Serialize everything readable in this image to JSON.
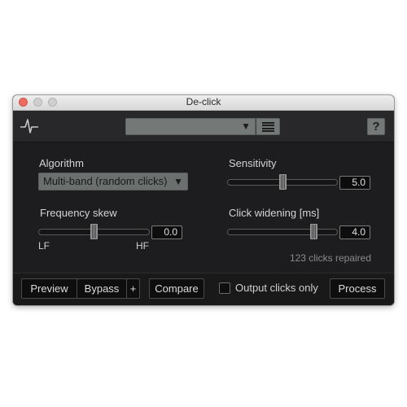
{
  "window": {
    "title": "De-click"
  },
  "header": {
    "preset_value": "",
    "preset_arrow": "▼",
    "help_label": "?"
  },
  "algorithm": {
    "label": "Algorithm",
    "value": "Multi-band (random clicks)",
    "arrow": "▼"
  },
  "sensitivity": {
    "label": "Sensitivity",
    "value": "5.0",
    "level": 0.5
  },
  "frequency_skew": {
    "label": "Frequency skew",
    "value": "0.0",
    "left_label": "LF",
    "right_label": "HF",
    "level": 0.5
  },
  "click_widening": {
    "label": "Click widening [ms]",
    "value": "4.0",
    "level": 0.78
  },
  "status": {
    "text": "123 clicks repaired"
  },
  "footer": {
    "preview": "Preview",
    "bypass": "Bypass",
    "plus": "+",
    "compare": "Compare",
    "output_clicks_only": "Output clicks only",
    "output_clicks_only_checked": false,
    "process": "Process"
  }
}
